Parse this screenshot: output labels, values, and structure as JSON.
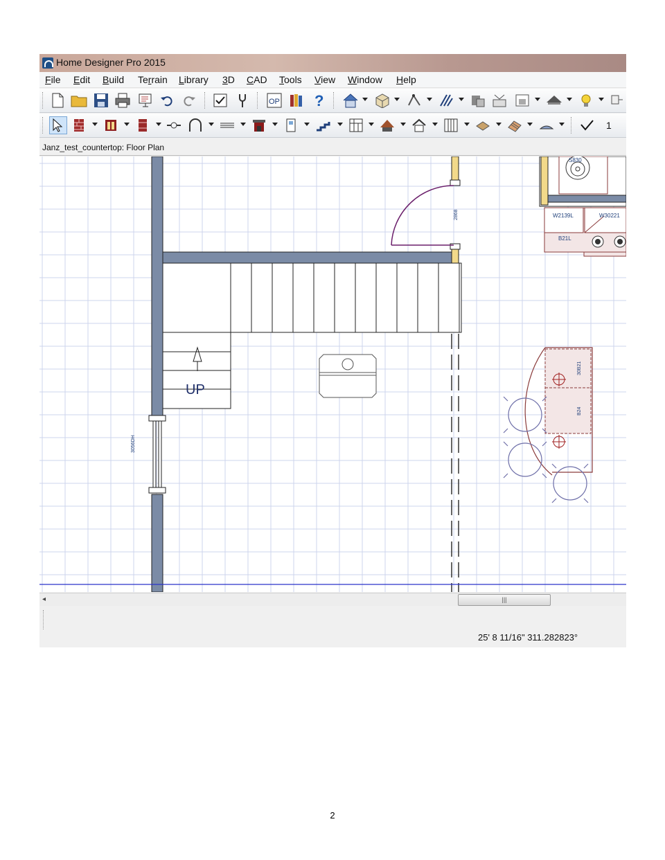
{
  "window": {
    "title": "Home Designer Pro 2015"
  },
  "menu": [
    {
      "pre": "",
      "acc": "F",
      "post": "ile"
    },
    {
      "pre": "",
      "acc": "E",
      "post": "dit"
    },
    {
      "pre": "",
      "acc": "B",
      "post": "uild"
    },
    {
      "pre": "Te",
      "acc": "r",
      "post": "rain"
    },
    {
      "pre": "",
      "acc": "L",
      "post": "ibrary"
    },
    {
      "pre": "",
      "acc": "3",
      "post": "D"
    },
    {
      "pre": "",
      "acc": "C",
      "post": "AD"
    },
    {
      "pre": "",
      "acc": "T",
      "post": "ools"
    },
    {
      "pre": "",
      "acc": "V",
      "post": "iew"
    },
    {
      "pre": "",
      "acc": "W",
      "post": "indow"
    },
    {
      "pre": "",
      "acc": "H",
      "post": "elp"
    }
  ],
  "toolbar2": {
    "last_value": "1"
  },
  "document": {
    "tab_title": "Janz_test_countertop: Floor Plan"
  },
  "plan": {
    "stair_label": "UP",
    "door_label": "2868",
    "window_label": "3056DH",
    "cab_sink_label": "S830",
    "cab_upper1": "W2139L",
    "cab_upper2": "W30221",
    "cab_base1": "B21L",
    "island_label1": "30B21",
    "island_label2": "B24"
  },
  "status": {
    "coordinates": "25' 8 11/16\" 311.282823°"
  },
  "page": {
    "number": "2"
  },
  "colors": {
    "wall_fill": "#7b8ba6",
    "grid_line": "#cdd4ec",
    "cabinet_fill": "#f3e6e6",
    "cabinet_line": "#8a3a3a",
    "door_arc": "#6b1f6b",
    "chair": "#6d6ea8",
    "guide_line": "#2b33c9"
  }
}
